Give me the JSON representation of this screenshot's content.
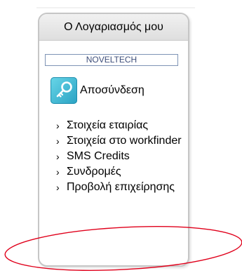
{
  "panel": {
    "title": "Ο Λογαριασμός μου",
    "company": "NOVELTECH",
    "logout": {
      "label": "Αποσύνδεση",
      "icon": "key-icon"
    },
    "menu": [
      {
        "label": "Στοιχεία εταιρίας"
      },
      {
        "label": "Στοιχεία στο workfinder"
      },
      {
        "label": "SMS Credits"
      },
      {
        "label": "Συνδρομές"
      },
      {
        "label": "Προβολή επιχείρησης"
      }
    ]
  },
  "annotation": {
    "ellipse_color": "#e0001b"
  }
}
